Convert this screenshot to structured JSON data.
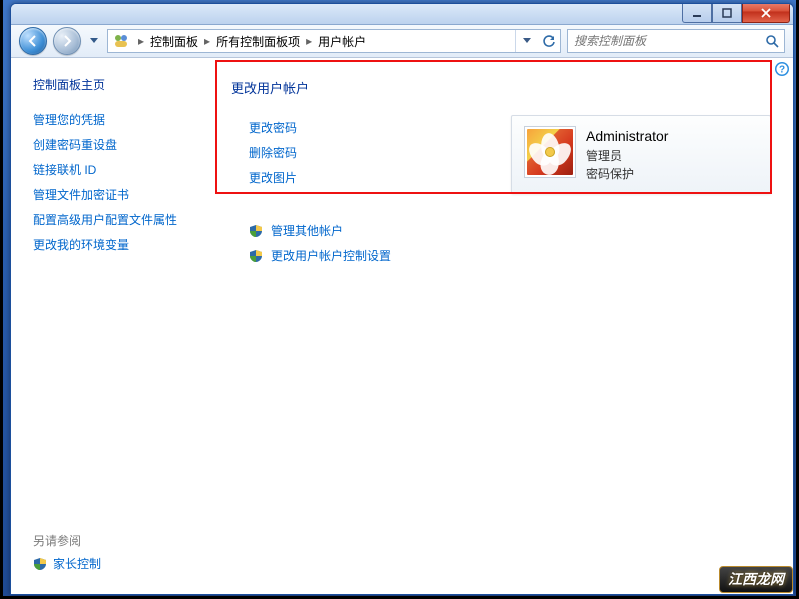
{
  "breadcrumb": {
    "level1": "控制面板",
    "level2": "所有控制面板项",
    "level3": "用户帐户"
  },
  "search": {
    "placeholder": "搜索控制面板"
  },
  "sidebar": {
    "title": "控制面板主页",
    "links": [
      "管理您的凭据",
      "创建密码重设盘",
      "链接联机 ID",
      "管理文件加密证书",
      "配置高级用户配置文件属性",
      "更改我的环境变量"
    ],
    "seealso": "另请参阅",
    "parental": "家长控制"
  },
  "main": {
    "section_title": "更改用户帐户",
    "actions": [
      "更改密码",
      "删除密码",
      "更改图片"
    ],
    "admin_actions": [
      "管理其他帐户",
      "更改用户帐户控制设置"
    ]
  },
  "user": {
    "name": "Administrator",
    "role": "管理员",
    "status": "密码保护"
  },
  "watermark": "江西龙网"
}
